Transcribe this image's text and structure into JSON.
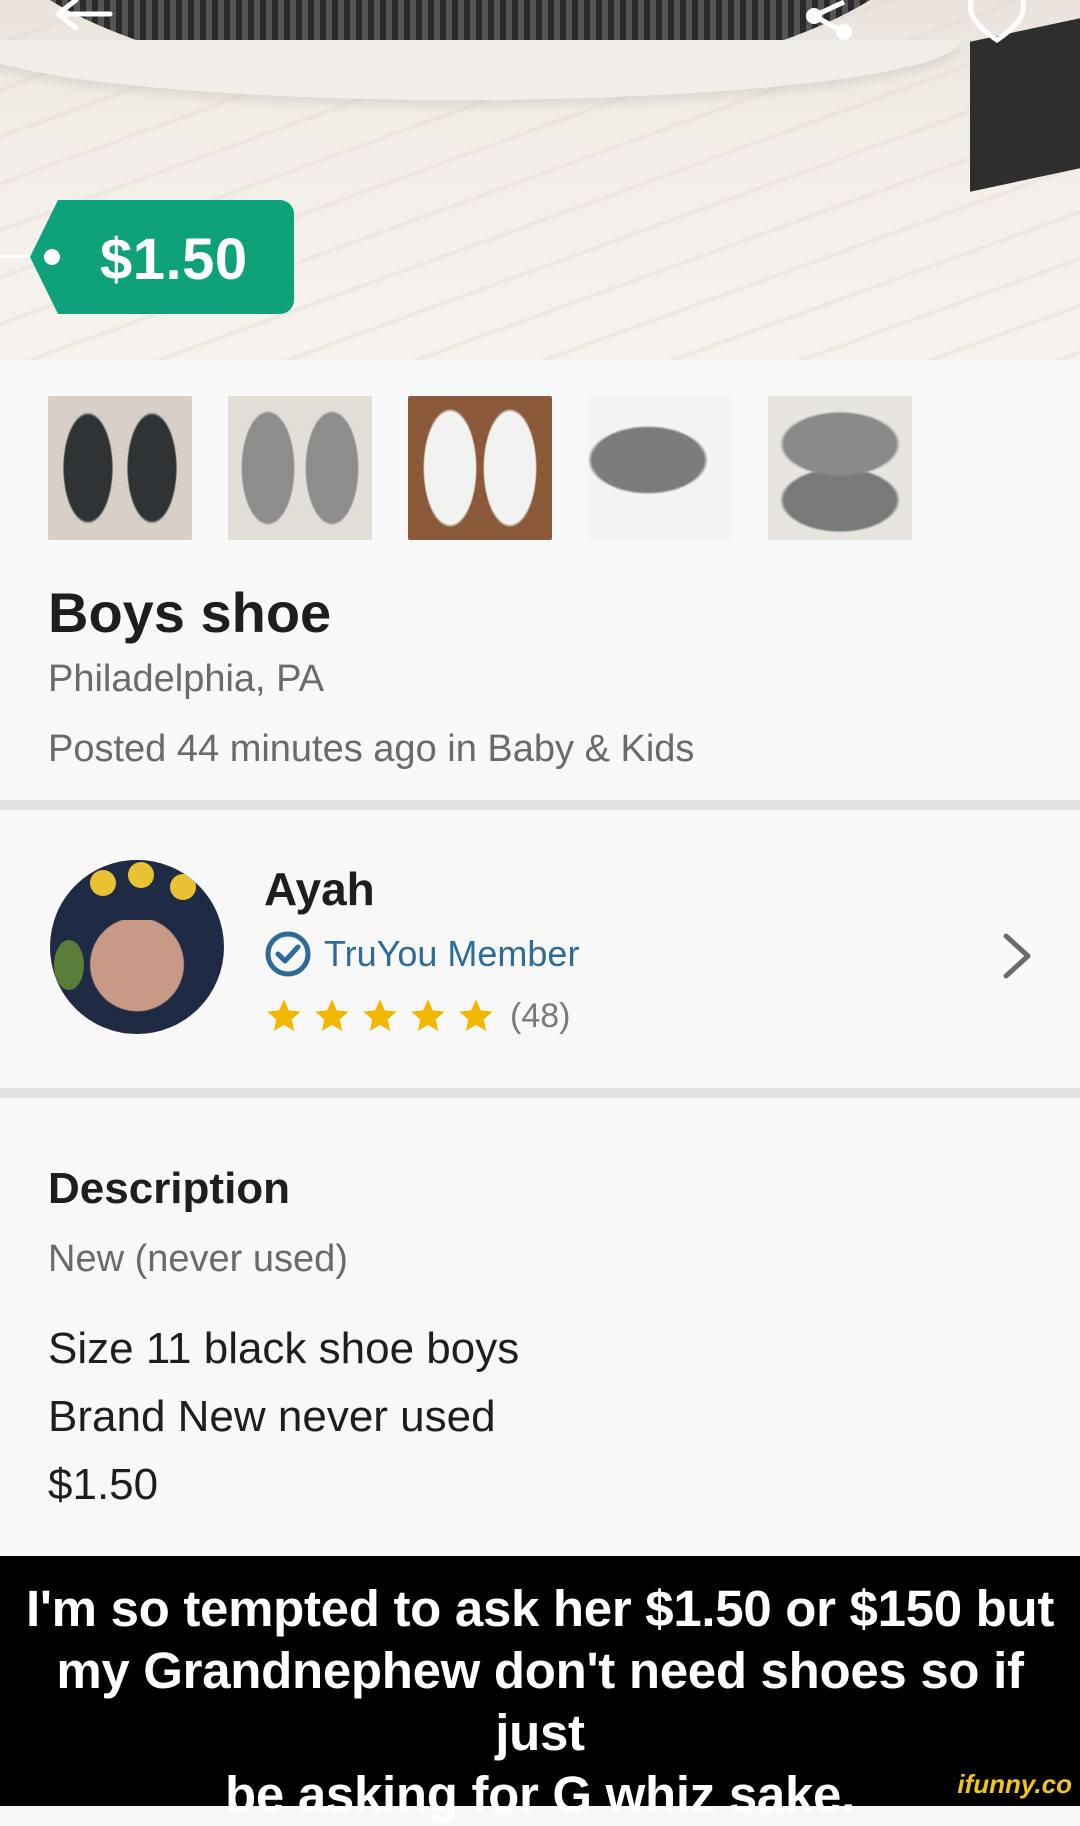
{
  "listing": {
    "price": "$1.50",
    "title": "Boys shoe",
    "location": "Philadelphia, PA",
    "posted": "Posted 44 minutes ago in Baby & Kids"
  },
  "icons": {
    "back": "back-arrow-icon",
    "share": "share-icon",
    "favorite": "heart-icon",
    "verified": "check-badge-icon",
    "star": "star-icon",
    "chevron": "chevron-right-icon"
  },
  "thumbnails": [
    "thumbnail-1",
    "thumbnail-2",
    "thumbnail-3",
    "thumbnail-4",
    "thumbnail-5"
  ],
  "seller": {
    "name": "Ayah",
    "badge": "TruYou Member",
    "rating_stars": 5,
    "rating_count": "(48)"
  },
  "description": {
    "heading": "Description",
    "condition": "New (never used)",
    "lines": [
      "Size 11 black shoe boys",
      "Brand New never used",
      "$1.50"
    ]
  },
  "caption": {
    "line1": "I'm  so tempted to ask her $1.50 or $150 but",
    "line2": "my Grandnephew don't need shoes so if just",
    "line3": "be asking for G whiz sake.",
    "watermark": "ifunny.co"
  },
  "colors": {
    "price_tag": "#0fa27a",
    "badge": "#2f6b9a",
    "star": "#f5b800"
  }
}
